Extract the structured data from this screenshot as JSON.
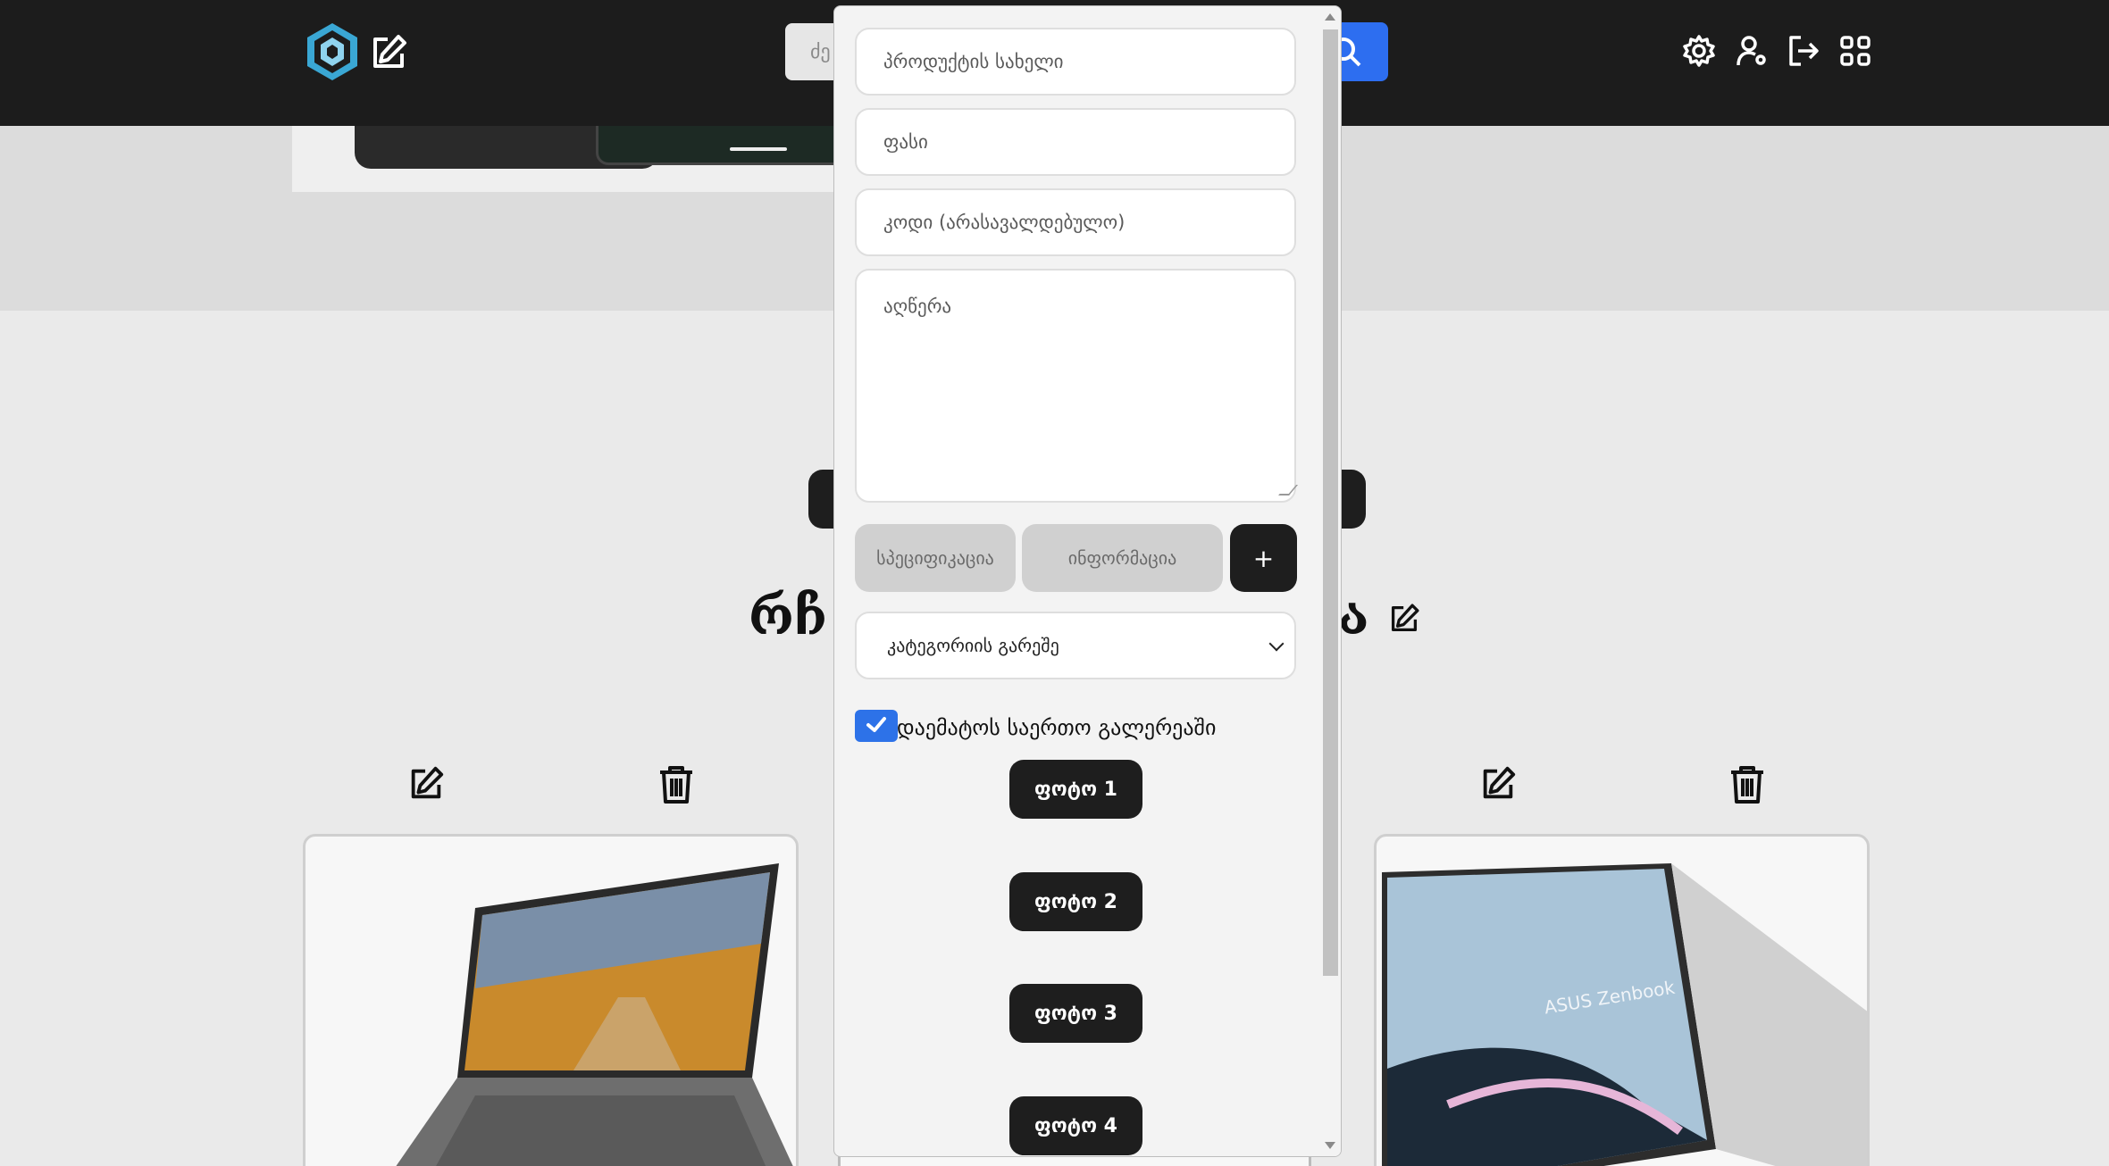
{
  "header": {
    "search_placeholder": "ძე",
    "icons": [
      "logo-icon",
      "edit-icon",
      "search-icon",
      "settings-icon",
      "user-settings-icon",
      "logout-icon",
      "apps-grid-icon"
    ]
  },
  "page": {
    "title_left": "რჩ",
    "title_right": "ა"
  },
  "modal": {
    "product_name_placeholder": "პროდუქტის სახელი",
    "price_placeholder": "ფასი",
    "code_placeholder": "კოდი (არასავალდებულო)",
    "description_placeholder": "აღწერა",
    "spec_placeholder": "სპეციფიკაცია",
    "info_placeholder": "ინფორმაცია",
    "add_label": "+",
    "category_selected": "კატეგორიის გარეშე",
    "gallery_checkbox_label": "დაემატოს საერთო გალერეაში",
    "gallery_checked": true,
    "photo_buttons": [
      "ფოტო 1",
      "ფოტო 2",
      "ფოტო 3",
      "ფოტო 4"
    ]
  },
  "cards": {
    "right_card_brand": "ASUS Zenbook"
  },
  "colors": {
    "header_bg": "#1c1c1c",
    "accent_blue": "#2d6ef0",
    "dark_button": "#1e1e1e"
  }
}
